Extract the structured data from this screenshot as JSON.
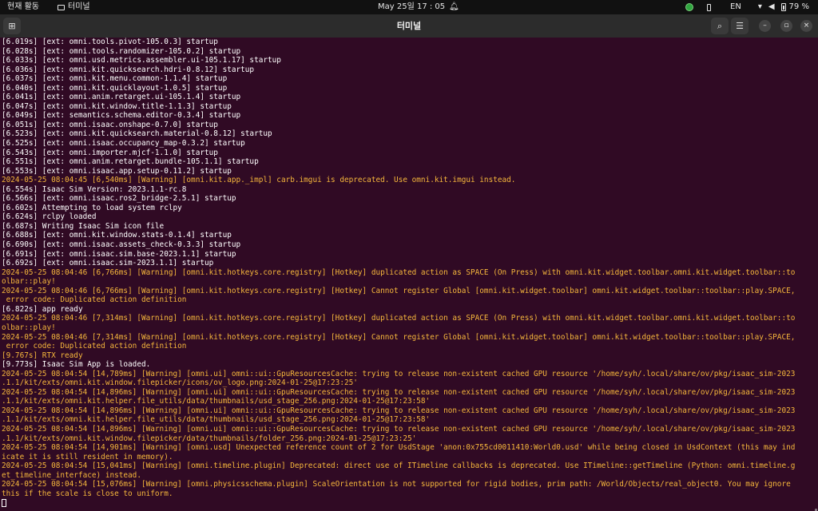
{
  "topbar": {
    "activities": "현재 활동",
    "app_name": "터미널",
    "clock": "May 25일  17 : 05",
    "lang": "EN",
    "battery": "79 %"
  },
  "window": {
    "title": "터미널"
  },
  "terminal": {
    "lines": [
      {
        "t": "[6.019s] [ext: omni.tools.pivot-105.0.3] startup",
        "w": false
      },
      {
        "t": "[6.028s] [ext: omni.tools.randomizer-105.0.2] startup",
        "w": false
      },
      {
        "t": "[6.033s] [ext: omni.usd.metrics.assembler.ui-105.1.17] startup",
        "w": false
      },
      {
        "t": "[6.036s] [ext: omni.kit.quicksearch.hdri-0.8.12] startup",
        "w": false
      },
      {
        "t": "[6.037s] [ext: omni.kit.menu.common-1.1.4] startup",
        "w": false
      },
      {
        "t": "[6.040s] [ext: omni.kit.quicklayout-1.0.5] startup",
        "w": false
      },
      {
        "t": "[6.041s] [ext: omni.anim.retarget.ui-105.1.4] startup",
        "w": false
      },
      {
        "t": "[6.047s] [ext: omni.kit.window.title-1.1.3] startup",
        "w": false
      },
      {
        "t": "[6.049s] [ext: semantics.schema.editor-0.3.4] startup",
        "w": false
      },
      {
        "t": "[6.051s] [ext: omni.isaac.onshape-0.7.0] startup",
        "w": false
      },
      {
        "t": "[6.523s] [ext: omni.kit.quicksearch.material-0.8.12] startup",
        "w": false
      },
      {
        "t": "[6.525s] [ext: omni.isaac.occupancy_map-0.3.2] startup",
        "w": false
      },
      {
        "t": "[6.543s] [ext: omni.importer.mjcf-1.1.0] startup",
        "w": false
      },
      {
        "t": "[6.551s] [ext: omni.anim.retarget.bundle-105.1.1] startup",
        "w": false
      },
      {
        "t": "[6.553s] [ext: omni.isaac.app.setup-0.11.2] startup",
        "w": false
      },
      {
        "t": "2024-05-25 08:04:45 [6,540ms] [Warning] [omni.kit.app._impl] carb.imgui is deprecated. Use omni.kit.imgui instead.",
        "w": true
      },
      {
        "t": "[6.554s] Isaac Sim Version: 2023.1.1-rc.8",
        "w": false
      },
      {
        "t": "[6.566s] [ext: omni.isaac.ros2_bridge-2.5.1] startup",
        "w": false
      },
      {
        "t": "[6.602s] Attempting to load system rclpy",
        "w": false
      },
      {
        "t": "[6.624s] rclpy loaded",
        "w": false
      },
      {
        "t": "[6.687s] Writing Isaac Sim icon file",
        "w": false
      },
      {
        "t": "[6.688s] [ext: omni.kit.window.stats-0.1.4] startup",
        "w": false
      },
      {
        "t": "[6.690s] [ext: omni.isaac.assets_check-0.3.3] startup",
        "w": false
      },
      {
        "t": "[6.691s] [ext: omni.isaac.sim.base-2023.1.1] startup",
        "w": false
      },
      {
        "t": "[6.692s] [ext: omni.isaac.sim-2023.1.1] startup",
        "w": false
      },
      {
        "t": "2024-05-25 08:04:46 [6,766ms] [Warning] [omni.kit.hotkeys.core.registry] [Hotkey] duplicated action as SPACE (On Press) with omni.kit.widget.toolbar.omni.kit.widget.toolbar::to",
        "w": true
      },
      {
        "t": "olbar::play!",
        "w": true
      },
      {
        "t": "2024-05-25 08:04:46 [6,766ms] [Warning] [omni.kit.hotkeys.core.registry] [Hotkey] Cannot register Global [omni.kit.widget.toolbar] omni.kit.widget.toolbar::toolbar::play.SPACE,",
        "w": true
      },
      {
        "t": " error code: Duplicated action definition",
        "w": true
      },
      {
        "t": "[6.822s] app ready",
        "w": false
      },
      {
        "t": "2024-05-25 08:04:46 [7,314ms] [Warning] [omni.kit.hotkeys.core.registry] [Hotkey] duplicated action as SPACE (On Press) with omni.kit.widget.toolbar.omni.kit.widget.toolbar::to",
        "w": true
      },
      {
        "t": "olbar::play!",
        "w": true
      },
      {
        "t": "2024-05-25 08:04:46 [7,314ms] [Warning] [omni.kit.hotkeys.core.registry] [Hotkey] Cannot register Global [omni.kit.widget.toolbar] omni.kit.widget.toolbar::toolbar::play.SPACE,",
        "w": true
      },
      {
        "t": " error code: Duplicated action definition",
        "w": true
      },
      {
        "t": "[9.767s] RTX ready",
        "w": true
      },
      {
        "t": "[9.773s] Isaac Sim App is loaded.",
        "w": false
      },
      {
        "t": "2024-05-25 08:04:54 [14,789ms] [Warning] [omni.ui] omni::ui::GpuResourcesCache: trying to release non-existent cached GPU resource '/home/syh/.local/share/ov/pkg/isaac_sim-2023",
        "w": true
      },
      {
        "t": ".1.1/kit/exts/omni.kit.window.filepicker/icons/ov_logo.png:2024-01-25@17:23:25'",
        "w": true
      },
      {
        "t": "2024-05-25 08:04:54 [14,896ms] [Warning] [omni.ui] omni::ui::GpuResourcesCache: trying to release non-existent cached GPU resource '/home/syh/.local/share/ov/pkg/isaac_sim-2023",
        "w": true
      },
      {
        "t": ".1.1/kit/exts/omni.kit.helper.file_utils/data/thumbnails/usd_stage_256.png:2024-01-25@17:23:58'",
        "w": true
      },
      {
        "t": "2024-05-25 08:04:54 [14,896ms] [Warning] [omni.ui] omni::ui::GpuResourcesCache: trying to release non-existent cached GPU resource '/home/syh/.local/share/ov/pkg/isaac_sim-2023",
        "w": true
      },
      {
        "t": ".1.1/kit/exts/omni.kit.helper.file_utils/data/thumbnails/usd_stage_256.png:2024-01-25@17:23:58'",
        "w": true
      },
      {
        "t": "2024-05-25 08:04:54 [14,896ms] [Warning] [omni.ui] omni::ui::GpuResourcesCache: trying to release non-existent cached GPU resource '/home/syh/.local/share/ov/pkg/isaac_sim-2023",
        "w": true
      },
      {
        "t": ".1.1/kit/exts/omni.kit.window.filepicker/data/thumbnails/folder_256.png:2024-01-25@17:23:25'",
        "w": true
      },
      {
        "t": "2024-05-25 08:04:54 [14,901ms] [Warning] [omni.usd] Unexpected reference count of 2 for UsdStage 'anon:0x755cd0011410:World0.usd' while being closed in UsdContext (this may ind",
        "w": true
      },
      {
        "t": "icate it is still resident in memory).",
        "w": true
      },
      {
        "t": "2024-05-25 08:04:54 [15,041ms] [Warning] [omni.timeline.plugin] Deprecated: direct use of ITimeline callbacks is deprecated. Use ITimeline::getTimeline (Python: omni.timeline.g",
        "w": true
      },
      {
        "t": "et_timeline_interface) instead.",
        "w": true
      },
      {
        "t": "2024-05-25 08:04:54 [15,076ms] [Warning] [omni.physicsschema.plugin] ScaleOrientation is not supported for rigid bodies, prim path: /World/Objects/real_object0. You may ignore",
        "w": true
      },
      {
        "t": "this if the scale is close to uniform.",
        "w": true
      }
    ]
  }
}
